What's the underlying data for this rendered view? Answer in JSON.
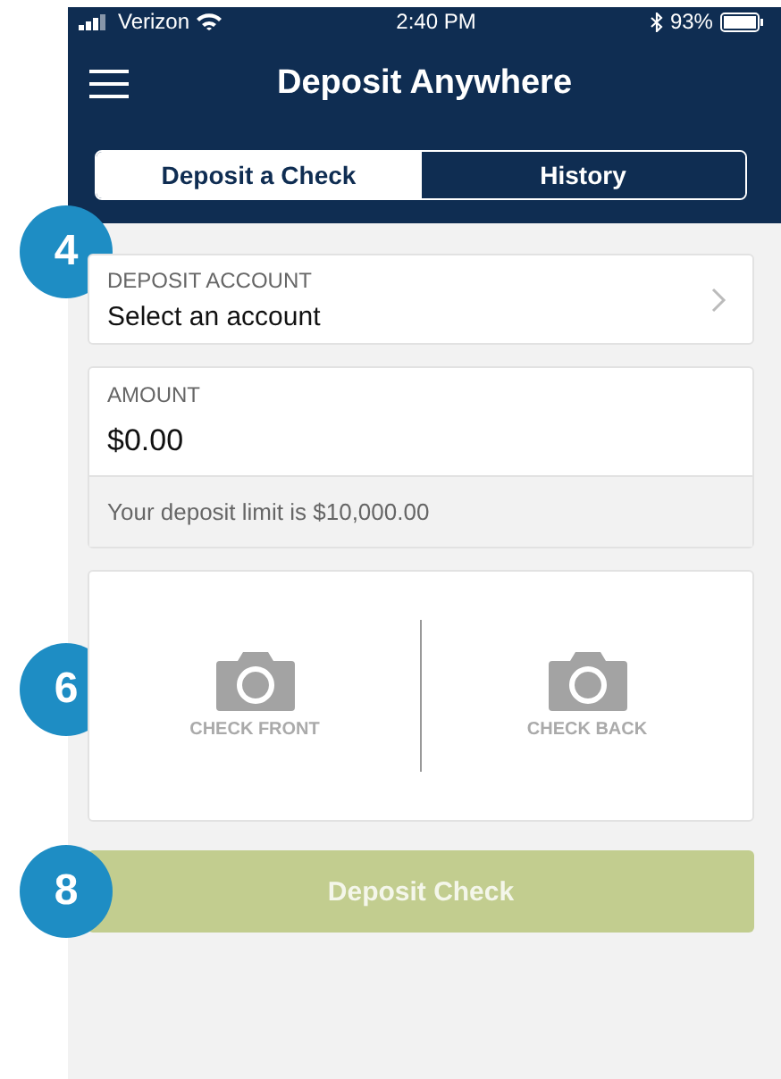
{
  "status_bar": {
    "carrier": "Verizon",
    "time": "2:40 PM",
    "battery": "93%"
  },
  "header": {
    "title": "Deposit Anywhere"
  },
  "tabs": [
    {
      "label": "Deposit a Check",
      "selected": true
    },
    {
      "label": "History",
      "selected": false
    }
  ],
  "account": {
    "label": "DEPOSIT ACCOUNT",
    "value": "Select an account",
    "callout": "4"
  },
  "amount": {
    "label": "AMOUNT",
    "value": "$0.00",
    "note": "Your deposit limit is $10,000.00"
  },
  "captures": {
    "callout": "6",
    "items": [
      {
        "label": "CHECK FRONT"
      },
      {
        "label": "CHECK BACK"
      }
    ]
  },
  "submit": {
    "label": "Deposit Check",
    "disabled": true,
    "callout": "8"
  }
}
